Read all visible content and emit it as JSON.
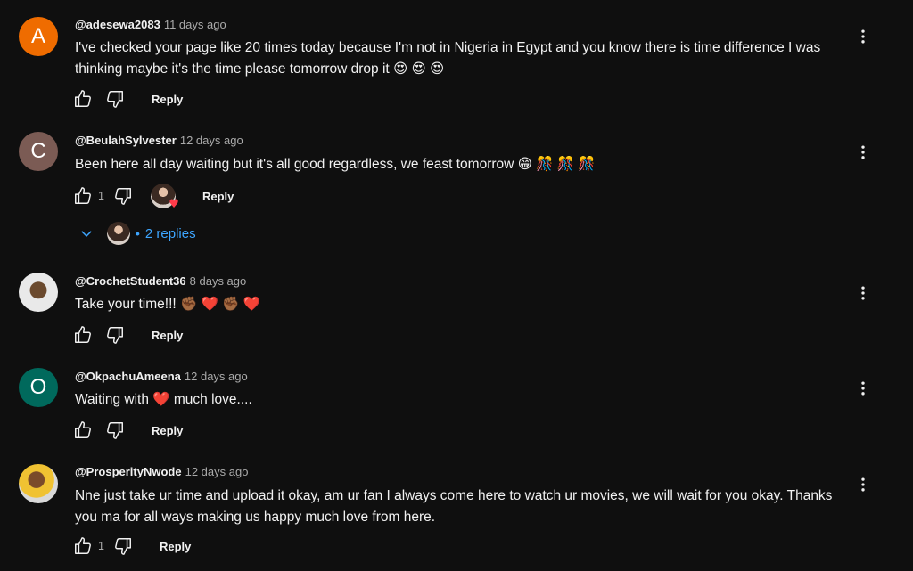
{
  "comments": [
    {
      "avatar_letter": "A",
      "avatar_color": "#ef6c00",
      "author": "@adesewa2083",
      "time": "11 days ago",
      "text": "I've checked your page like 20 times today because I'm not in Nigeria in Egypt and you know there is time difference I was thinking maybe it's the time please tomorrow drop it 😍 😍 😍",
      "likes": "",
      "reply_label": "Reply"
    },
    {
      "avatar_letter": "C",
      "avatar_color": "#7b5b54",
      "author": "@BeulahSylvester",
      "time": "12 days ago",
      "text": "Been here all day waiting but it's all good regardless, we feast tomorrow 😁 🎊 🎊 🎊",
      "likes": "1",
      "reply_label": "Reply",
      "replies_label": "2 replies"
    },
    {
      "author": "@CrochetStudent36",
      "time": "8 days ago",
      "text": "Take your time!!! ✊🏾 ❤️ ✊🏾 ❤️",
      "likes": "",
      "reply_label": "Reply"
    },
    {
      "avatar_letter": "O",
      "avatar_color": "#00695c",
      "author": "@OkpachuAmeena",
      "time": "12 days ago",
      "text": "Waiting with ❤️ much love....",
      "likes": "",
      "reply_label": "Reply"
    },
    {
      "author": "@ProsperityNwode",
      "time": "12 days ago",
      "text": "Nne just take ur time and upload it okay, am ur fan I always come here to watch ur movies, we will wait for you okay. Thanks you ma for all ways making us happy much love from here.",
      "likes": "1",
      "reply_label": "Reply"
    }
  ],
  "icons": {
    "like": "thumb-up-icon",
    "dislike": "thumb-down-icon",
    "menu": "more-vert-icon",
    "expand": "chevron-down-icon",
    "creator_heart": "creator-heart-icon"
  }
}
